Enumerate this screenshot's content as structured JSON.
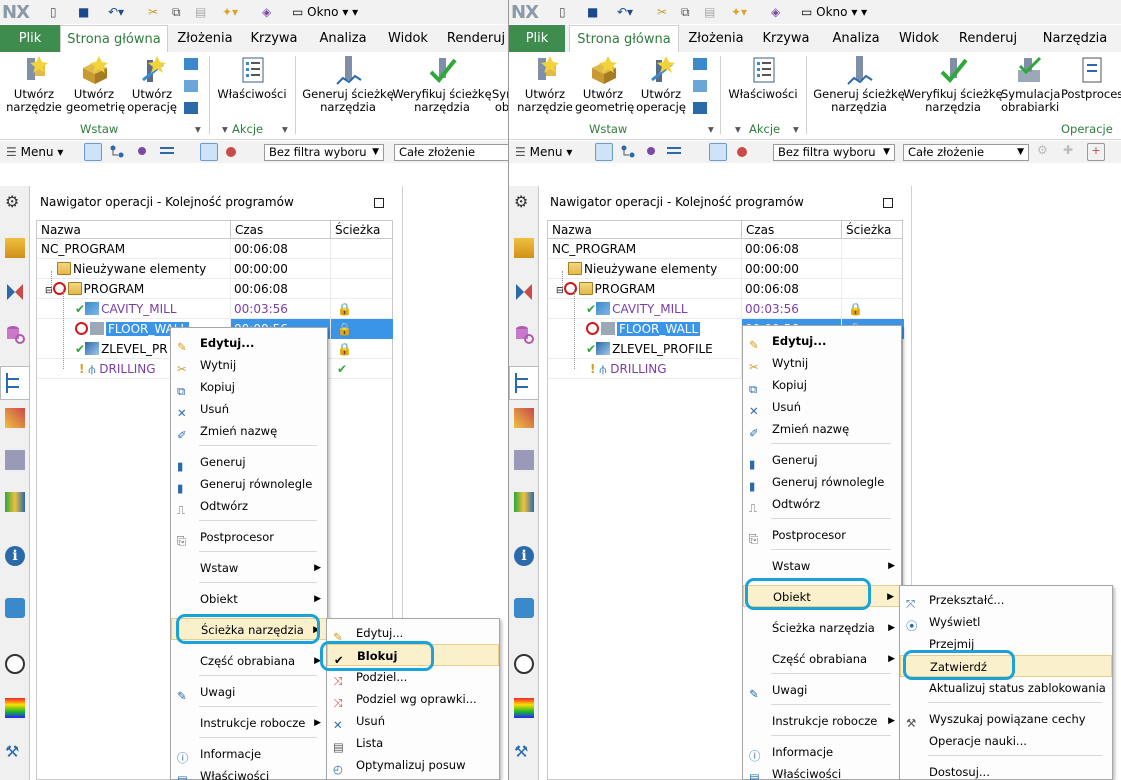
{
  "app": {
    "logo": "NX",
    "window_menu": "Okno"
  },
  "ribbon": {
    "tabs_left": [
      "Plik",
      "Strona główna",
      "Złożenia",
      "Krzywa",
      "Analiza",
      "Widok",
      "Renderuj"
    ],
    "tabs_right": [
      "Plik",
      "Strona główna",
      "Złożenia",
      "Krzywa",
      "Analiza",
      "Widok",
      "Renderuj",
      "Narzędzia"
    ],
    "buttons": {
      "create_tool": "Utwórz narzędzie",
      "create_geometry": "Utwórz geometrię",
      "create_operation": "Utwórz operację",
      "properties": "Właściwości",
      "generate_path": "Generuj ścieżkę narzędzia",
      "verify_path": "Weryfikuj ścieżkę narzędzia",
      "simulate_left": "Sym ob",
      "simulate": "Symulacja obrabiarki",
      "postprocess": "Postproces"
    },
    "groups": {
      "insert": "Wstaw",
      "actions": "Akcje",
      "operations": "Operacje"
    }
  },
  "toolbar": {
    "menu": "Menu",
    "filter": "Bez filtra wyboru",
    "scope": "Całe złożenie"
  },
  "navigator": {
    "title": "Nawigator operacji - Kolejność programów",
    "columns": [
      "Nazwa",
      "Czas",
      "Ścieżka"
    ],
    "rows": [
      {
        "name": "NC_PROGRAM",
        "time": "00:06:08"
      },
      {
        "name": "Nieużywane elementy",
        "time": "00:00:00"
      },
      {
        "name": "PROGRAM",
        "time": "00:06:08"
      },
      {
        "name": "CAVITY_MILL",
        "time": "00:03:56"
      },
      {
        "name": "FLOOR_WALL",
        "time": "00:00:56"
      },
      {
        "name": "ZLEVEL_PROFILE",
        "time": ""
      },
      {
        "name": "DRILLING",
        "time": ""
      }
    ],
    "left_truncated_zlevel": "ZLEVEL_PR"
  },
  "context_menu": {
    "items": [
      "Edytuj...",
      "Wytnij",
      "Kopiuj",
      "Usuń",
      "Zmień nazwę",
      "Generuj",
      "Generuj równolegle",
      "Odtwórz",
      "Postprocesor",
      "Wstaw",
      "Obiekt",
      "Ścieżka narzędzia",
      "Część obrabiana",
      "Uwagi",
      "Instrukcje robocze",
      "Informacje",
      "Właściwości"
    ]
  },
  "submenu_path": {
    "items": [
      "Edytuj...",
      "Blokuj",
      "Podziel...",
      "Podziel wg oprawki...",
      "Usuń",
      "Lista",
      "Optymalizuj posuw"
    ]
  },
  "submenu_object": {
    "items": [
      "Przekształć...",
      "Wyświetl",
      "Przejmij",
      "Zatwierdź",
      "Aktualizuj status zablokowania",
      "Wyszukaj powiązane cechy",
      "Operacje nauki...",
      "Dostosuj..."
    ]
  },
  "colors": {
    "accent_green": "#2f7b3d",
    "file_tab": "#3f8c4f",
    "selection": "#3a94e8",
    "highlight_oval": "#1aa3d9",
    "op_purple": "#7a3ea8"
  }
}
